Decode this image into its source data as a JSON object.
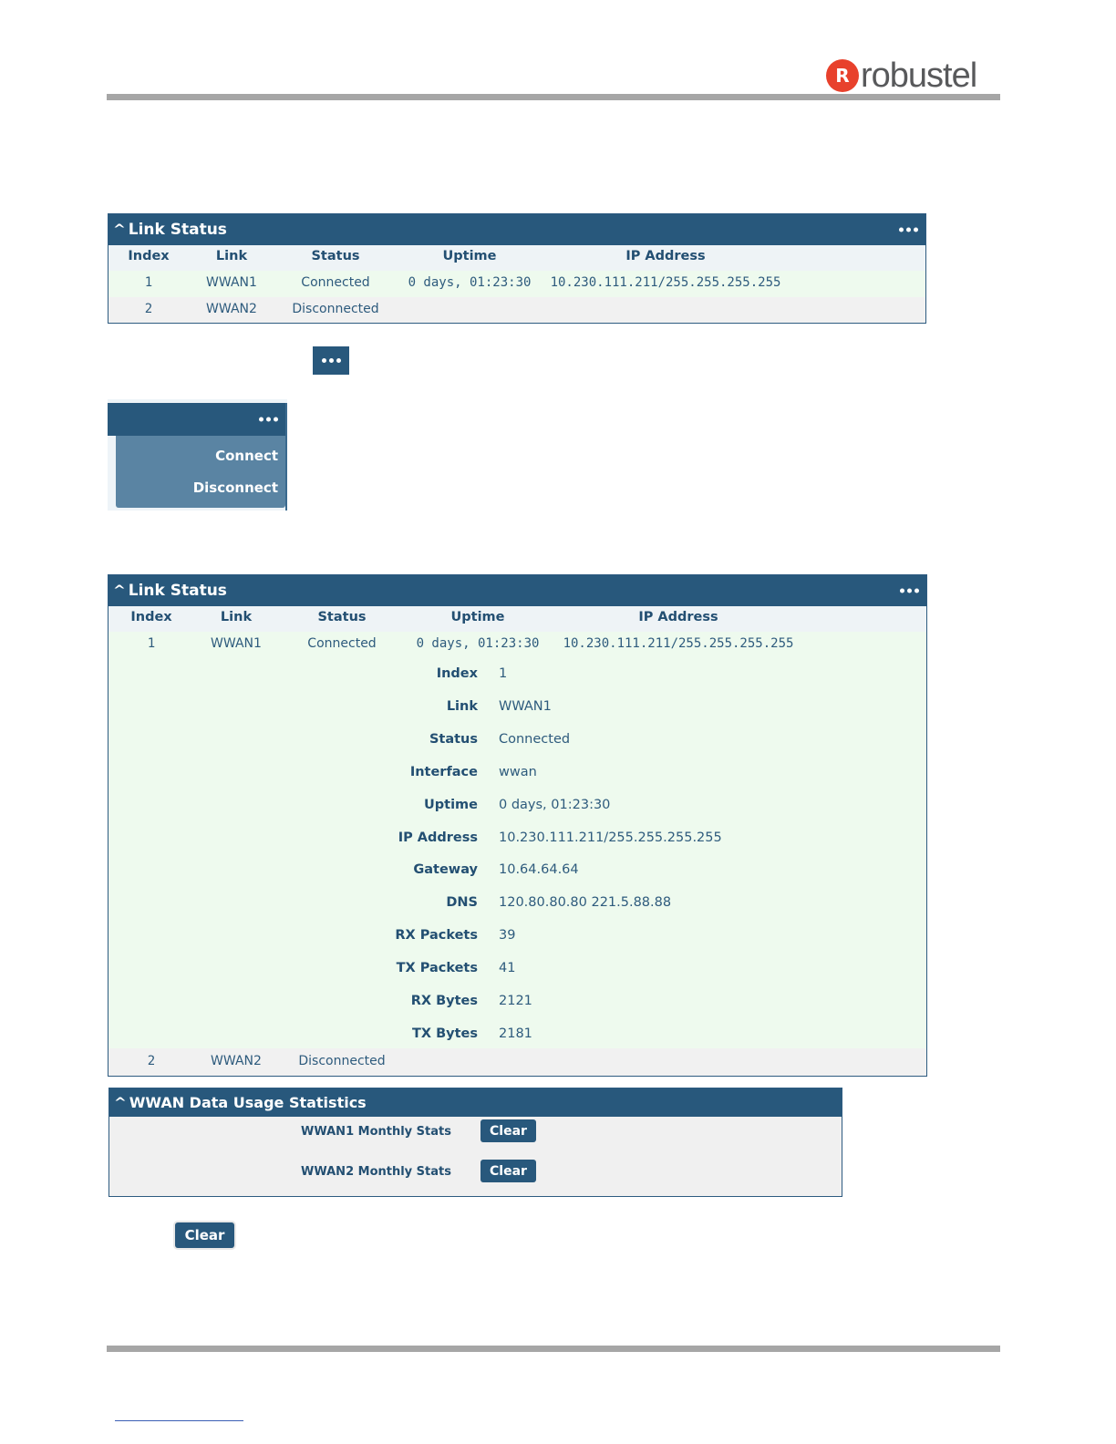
{
  "header": {
    "logo_mark": "R",
    "logo_text": "robustel"
  },
  "link_status_1": {
    "title": "Link Status",
    "columns": [
      "Index",
      "Link",
      "Status",
      "Uptime",
      "IP Address"
    ],
    "rows": [
      [
        "1",
        "WWAN1",
        "Connected",
        "0 days, 01:23:30",
        "10.230.111.211/255.255.255.255"
      ],
      [
        "2",
        "WWAN2",
        "Disconnected",
        "",
        ""
      ]
    ]
  },
  "menu": {
    "items": [
      "Connect",
      "Disconnect"
    ]
  },
  "link_status_2": {
    "title": "Link Status",
    "columns": [
      "Index",
      "Link",
      "Status",
      "Uptime",
      "IP Address"
    ],
    "row1": [
      "1",
      "WWAN1",
      "Connected",
      "0 days, 01:23:30",
      "10.230.111.211/255.255.255.255"
    ],
    "details": [
      {
        "label": "Index",
        "value": "1"
      },
      {
        "label": "Link",
        "value": "WWAN1"
      },
      {
        "label": "Status",
        "value": "Connected"
      },
      {
        "label": "Interface",
        "value": "wwan"
      },
      {
        "label": "Uptime",
        "value": "0 days, 01:23:30"
      },
      {
        "label": "IP Address",
        "value": "10.230.111.211/255.255.255.255"
      },
      {
        "label": "Gateway",
        "value": "10.64.64.64"
      },
      {
        "label": "DNS",
        "value": "120.80.80.80 221.5.88.88"
      },
      {
        "label": "RX Packets",
        "value": "39"
      },
      {
        "label": "TX Packets",
        "value": "41"
      },
      {
        "label": "RX Bytes",
        "value": "2121"
      },
      {
        "label": "TX Bytes",
        "value": "2181"
      }
    ],
    "row2": [
      "2",
      "WWAN2",
      "Disconnected"
    ]
  },
  "wwan_stats": {
    "title": "WWAN Data Usage Statistics",
    "rows": [
      {
        "label": "WWAN1 Monthly Stats",
        "button": "Clear"
      },
      {
        "label": "WWAN2 Monthly Stats",
        "button": "Clear"
      }
    ]
  },
  "standalone_clear": "Clear"
}
